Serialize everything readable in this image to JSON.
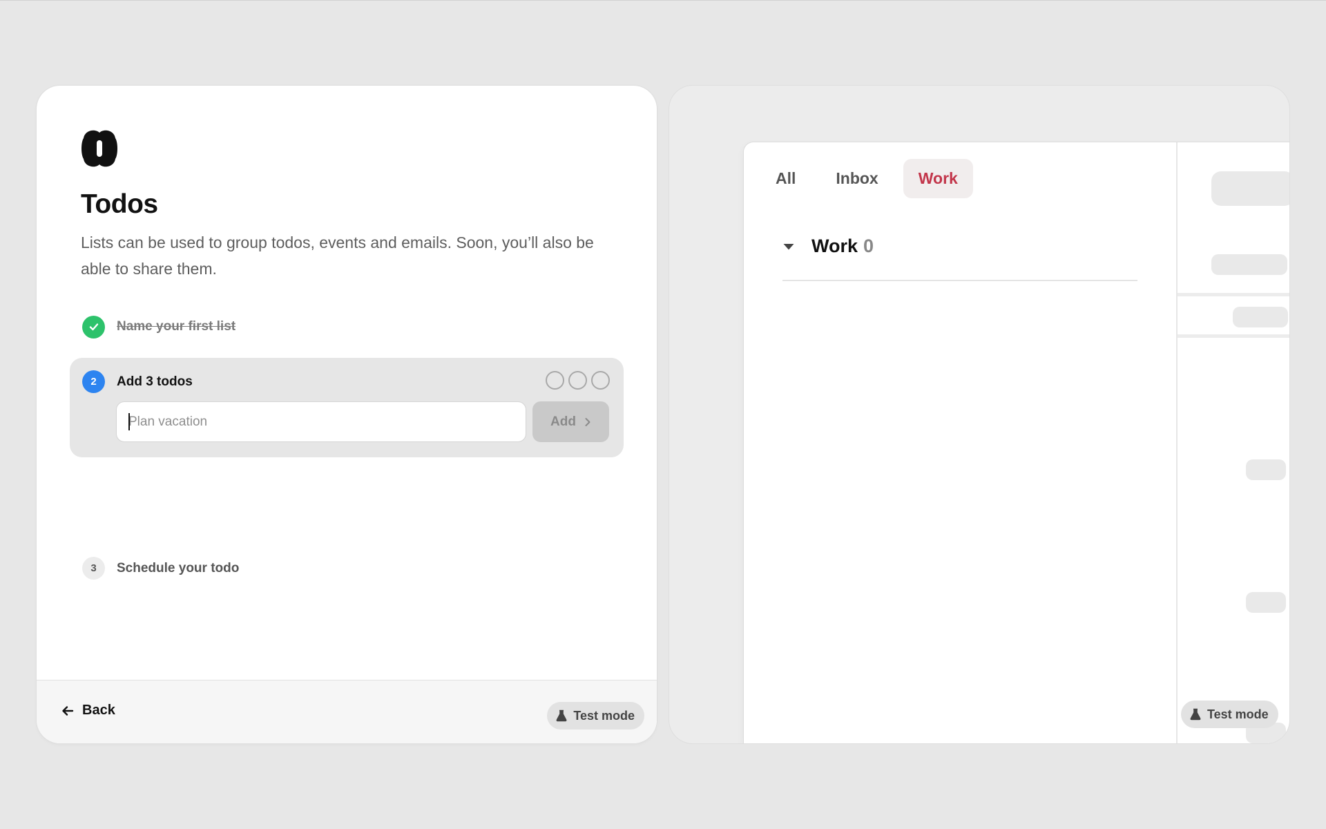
{
  "onboarding": {
    "title": "Todos",
    "description": "Lists can be used to group todos, events and emails. Soon, you’ll also be able to share them.",
    "steps": [
      {
        "number": "1",
        "label": "Name your first list",
        "status": "done"
      },
      {
        "number": "2",
        "label": "Add 3 todos",
        "status": "active",
        "progress_done": 0,
        "progress_total": 3
      },
      {
        "number": "3",
        "label": "Schedule your todo",
        "status": "pending"
      }
    ],
    "todo_input": {
      "value": "",
      "placeholder": "Plan vacation"
    },
    "add_button": "Add",
    "back_button": "Back",
    "test_mode": "Test mode"
  },
  "preview": {
    "tabs": [
      {
        "label": "All",
        "active": false
      },
      {
        "label": "Inbox",
        "active": false
      },
      {
        "label": "Work",
        "active": true
      }
    ],
    "list": {
      "name": "Work",
      "count": "0"
    },
    "test_mode": "Test mode"
  },
  "colors": {
    "success": "#2dc26b",
    "active_step": "#2d84f0",
    "active_tab_text": "#c2354a",
    "active_tab_bg": "#f1eded"
  }
}
